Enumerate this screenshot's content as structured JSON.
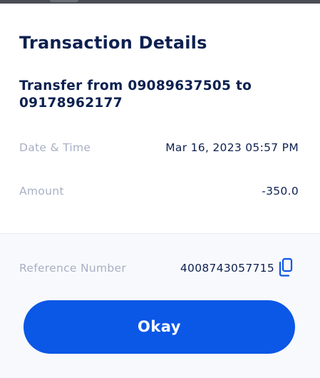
{
  "dialog": {
    "title": "Transaction Details",
    "description": "Transfer from 09089637505 to 09178962177"
  },
  "details": {
    "date_time": {
      "label": "Date & Time",
      "value": "Mar 16, 2023 05:57 PM"
    },
    "amount": {
      "label": "Amount",
      "value": "-350.0"
    },
    "reference": {
      "label": "Reference Number",
      "value": "4008743057715",
      "copy_icon": "copy-icon"
    }
  },
  "actions": {
    "okay_label": "Okay"
  },
  "colors": {
    "primary_text": "#0d2150",
    "muted_text": "#a7b0c3",
    "accent": "#0b57e6",
    "panel_bg": "#f8f9fc"
  }
}
